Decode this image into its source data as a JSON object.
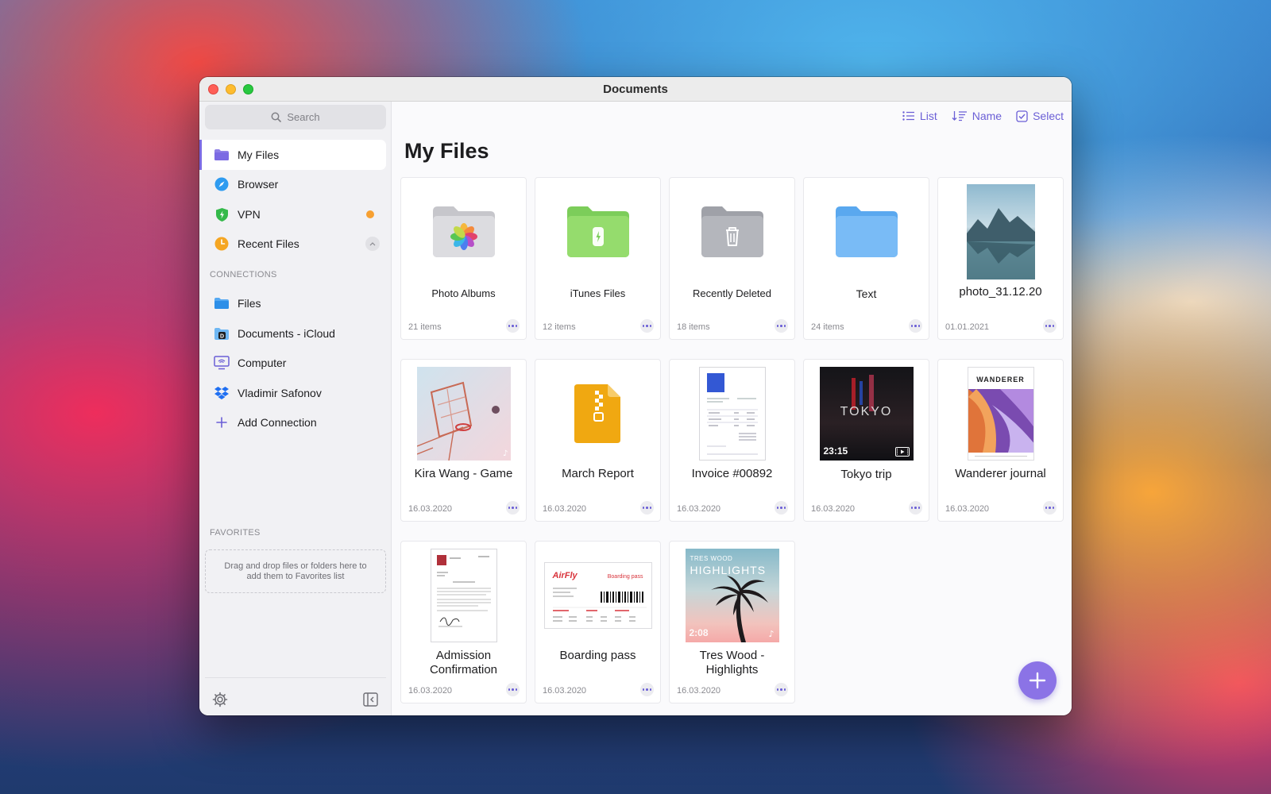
{
  "window": {
    "title": "Documents"
  },
  "sidebar": {
    "search_placeholder": "Search",
    "items": [
      {
        "label": "My Files",
        "icon": "folder-icon"
      },
      {
        "label": "Browser",
        "icon": "compass-icon"
      },
      {
        "label": "VPN",
        "icon": "shield-icon"
      },
      {
        "label": "Recent Files",
        "icon": "clock-icon"
      }
    ],
    "connections_label": "CONNECTIONS",
    "connections": [
      {
        "label": "Files",
        "icon": "folder-icon"
      },
      {
        "label": "Documents - iCloud",
        "icon": "cloud-folder-icon"
      },
      {
        "label": "Computer",
        "icon": "computer-icon"
      },
      {
        "label": "Vladimir Safonov",
        "icon": "dropbox-icon"
      },
      {
        "label": "Add Connection",
        "icon": "plus-icon"
      }
    ],
    "favorites_label": "FAVORITES",
    "favorites_hint": "Drag and drop files or folders here to add them to Favorites list"
  },
  "toolbar": {
    "list_label": "List",
    "sort_label": "Name",
    "select_label": "Select"
  },
  "main": {
    "title": "My Files"
  },
  "files": [
    {
      "name": "Photo Albums",
      "meta": "21 items",
      "kind": "photos-folder"
    },
    {
      "name": "iTunes Files",
      "meta": "12 items",
      "kind": "itunes-folder"
    },
    {
      "name": "Recently Deleted",
      "meta": "18 items",
      "kind": "trash-folder"
    },
    {
      "name": "Text",
      "meta": "24 items",
      "kind": "blue-folder"
    },
    {
      "name": "photo_31.12.20",
      "meta": "01.01.2021",
      "kind": "photo"
    },
    {
      "name": "Kira Wang - Game",
      "meta": "16.03.2020",
      "kind": "audio"
    },
    {
      "name": "March Report",
      "meta": "16.03.2020",
      "kind": "archive"
    },
    {
      "name": "Invoice #00892",
      "meta": "16.03.2020",
      "kind": "document"
    },
    {
      "name": "Tokyo trip",
      "meta": "16.03.2020",
      "kind": "video",
      "duration": "23:15",
      "overlay_text": "TOKYO"
    },
    {
      "name": "Wanderer journal",
      "meta": "16.03.2020",
      "kind": "magazine",
      "cover_text": "WANDERER"
    },
    {
      "name": "Admission Confirmation",
      "meta": "16.03.2020",
      "kind": "letter"
    },
    {
      "name": "Boarding pass",
      "meta": "16.03.2020",
      "kind": "ticket",
      "brand_text": "AirFly",
      "ticket_label": "Boarding pass"
    },
    {
      "name": "Tres Wood - Highlights",
      "meta": "16.03.2020",
      "kind": "audio-cover",
      "duration": "2:08",
      "cover_line1": "TRES WOOD",
      "cover_line2": "HIGHLIGHTS"
    }
  ],
  "colors": {
    "accent": "#6b5fd6",
    "fab": "#8b73e6",
    "vpn_dot": "#f7a031"
  }
}
